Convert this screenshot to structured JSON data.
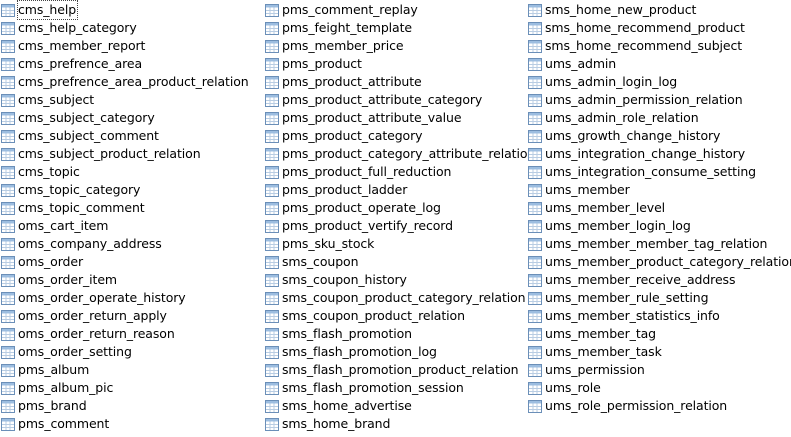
{
  "icon": "table-icon",
  "columns": [
    [
      "cms_help",
      "cms_help_category",
      "cms_member_report",
      "cms_prefrence_area",
      "cms_prefrence_area_product_relation",
      "cms_subject",
      "cms_subject_category",
      "cms_subject_comment",
      "cms_subject_product_relation",
      "cms_topic",
      "cms_topic_category",
      "cms_topic_comment",
      "oms_cart_item",
      "oms_company_address",
      "oms_order",
      "oms_order_item",
      "oms_order_operate_history",
      "oms_order_return_apply",
      "oms_order_return_reason",
      "oms_order_setting",
      "pms_album",
      "pms_album_pic",
      "pms_brand",
      "pms_comment"
    ],
    [
      "pms_comment_replay",
      "pms_feight_template",
      "pms_member_price",
      "pms_product",
      "pms_product_attribute",
      "pms_product_attribute_category",
      "pms_product_attribute_value",
      "pms_product_category",
      "pms_product_category_attribute_relation",
      "pms_product_full_reduction",
      "pms_product_ladder",
      "pms_product_operate_log",
      "pms_product_vertify_record",
      "pms_sku_stock",
      "sms_coupon",
      "sms_coupon_history",
      "sms_coupon_product_category_relation",
      "sms_coupon_product_relation",
      "sms_flash_promotion",
      "sms_flash_promotion_log",
      "sms_flash_promotion_product_relation",
      "sms_flash_promotion_session",
      "sms_home_advertise",
      "sms_home_brand"
    ],
    [
      "sms_home_new_product",
      "sms_home_recommend_product",
      "sms_home_recommend_subject",
      "ums_admin",
      "ums_admin_login_log",
      "ums_admin_permission_relation",
      "ums_admin_role_relation",
      "ums_growth_change_history",
      "ums_integration_change_history",
      "ums_integration_consume_setting",
      "ums_member",
      "ums_member_level",
      "ums_member_login_log",
      "ums_member_member_tag_relation",
      "ums_member_product_category_relation",
      "ums_member_receive_address",
      "ums_member_rule_setting",
      "ums_member_statistics_info",
      "ums_member_tag",
      "ums_member_task",
      "ums_permission",
      "ums_role",
      "ums_role_permission_relation"
    ]
  ],
  "selected": "cms_help",
  "colors": {
    "icon_border": "#6b8fb8",
    "icon_header": "#9cbde0",
    "icon_grid": "#b9cde3"
  }
}
